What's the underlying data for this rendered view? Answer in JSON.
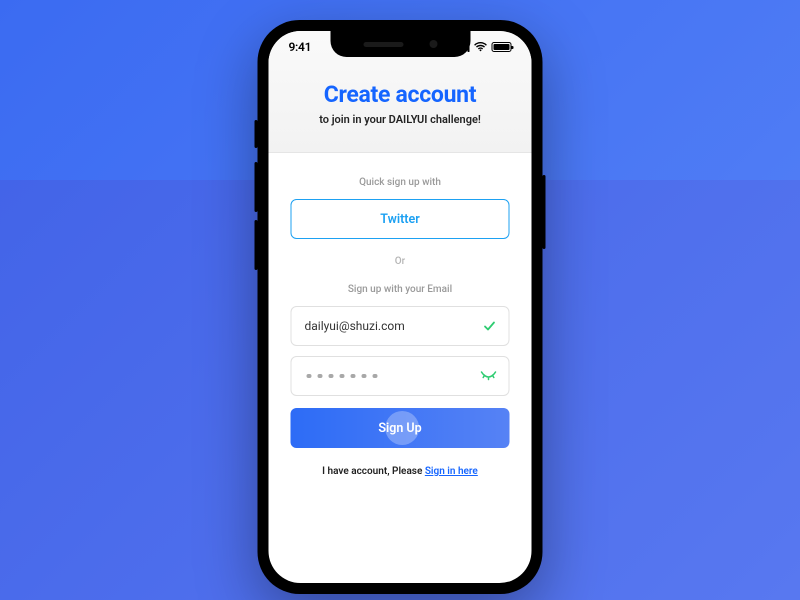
{
  "status": {
    "time": "9:41"
  },
  "header": {
    "title": "Create account",
    "subtitle": "to join in your DAILYUI challenge!"
  },
  "form": {
    "quick_label": "Quick sign up with",
    "twitter_label": "Twitter",
    "or_label": "Or",
    "email_label": "Sign up with your Email",
    "email_value": "dailyui@shuzi.com",
    "signup_label": "Sign Up"
  },
  "footer": {
    "prefix": "I have account, Please ",
    "link": "Sign in here"
  }
}
